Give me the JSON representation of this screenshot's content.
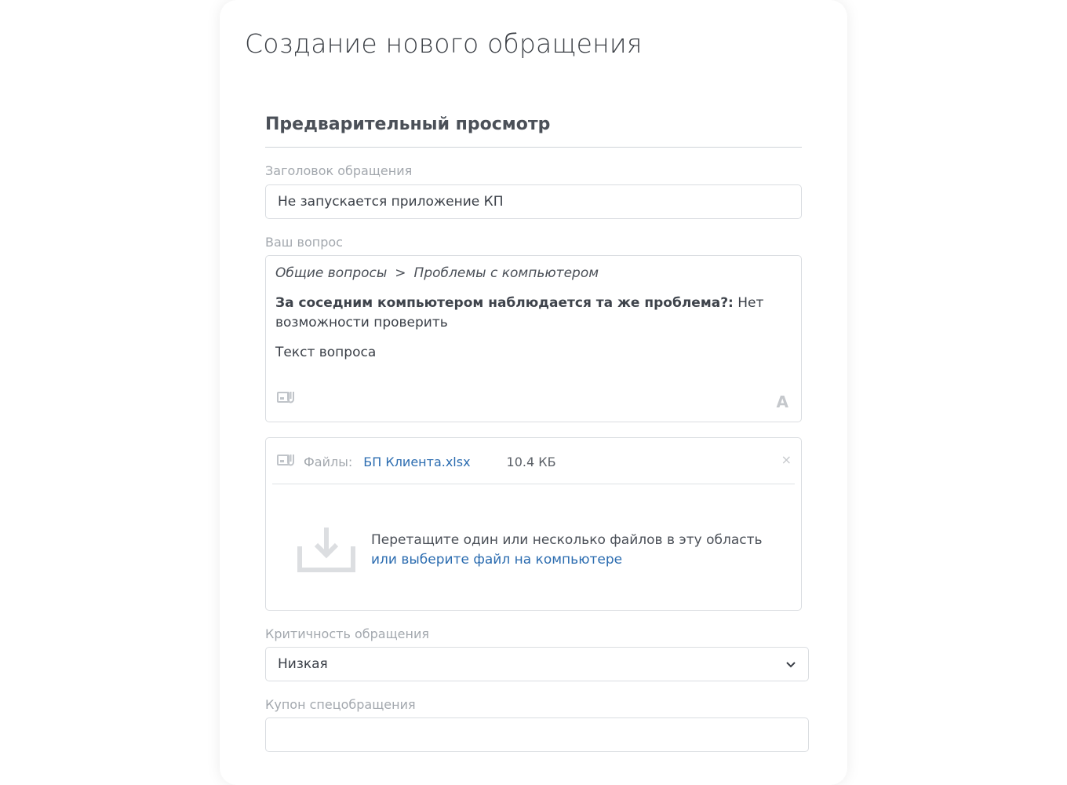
{
  "page": {
    "title": "Создание нового обращения"
  },
  "preview": {
    "section_title": "Предварительный просмотр"
  },
  "subject": {
    "label": "Заголовок обращения",
    "value": "Не запускается приложение КП"
  },
  "question": {
    "label": "Ваш вопрос",
    "breadcrumb": [
      "Общие вопросы",
      "Проблемы с компьютером"
    ],
    "breadcrumb_separator": ">",
    "qa_question": "За соседним компьютером наблюдается та же проблема?:",
    "qa_answer": "Нет возможности проверить",
    "text": "Текст вопроса",
    "attach_icon": "attachment-icon",
    "font_icon_glyph": "A"
  },
  "files": {
    "label": "Файлы:",
    "items": [
      {
        "name": "БП Клиента.xlsx",
        "size": "10.4 КБ"
      }
    ],
    "remove_glyph": "×",
    "drop_text": "Перетащите один или несколько файлов в эту область",
    "drop_link": "или выберите файл на компьютере"
  },
  "priority": {
    "label": "Критичность обращения",
    "selected": "Низкая"
  },
  "coupon": {
    "label": "Купон спецобращения",
    "value": ""
  },
  "colors": {
    "link": "#2b6cb0",
    "muted": "#a3a8ae",
    "border": "#dadde1"
  }
}
